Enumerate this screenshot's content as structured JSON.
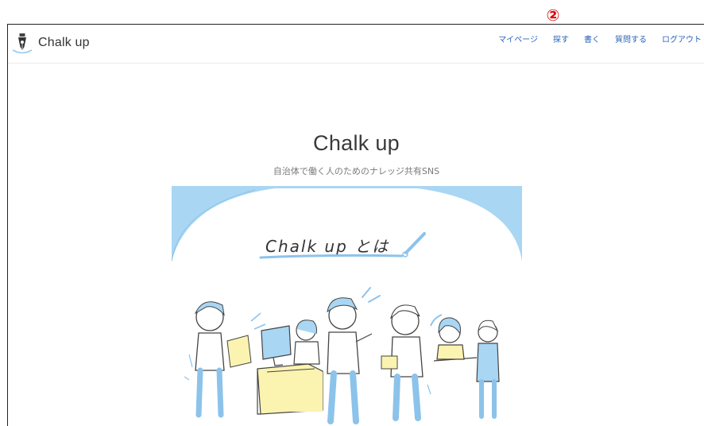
{
  "annotation": {
    "marker": "②"
  },
  "brand": {
    "name": "Chalk up"
  },
  "nav": {
    "items": [
      {
        "label": "マイページ"
      },
      {
        "label": "探す"
      },
      {
        "label": "書く"
      },
      {
        "label": "質問する"
      },
      {
        "label": "ログアウト"
      }
    ]
  },
  "hero": {
    "title": "Chalk up",
    "subtitle": "自治体で働く人のためのナレッジ共有SNS",
    "illustration_title": "Chalk up とは"
  },
  "colors": {
    "link": "#2a64b8",
    "illustration_blue": "#a9d6f3",
    "illustration_yellow": "#fbf3b0",
    "annotation_red": "#e00000"
  }
}
